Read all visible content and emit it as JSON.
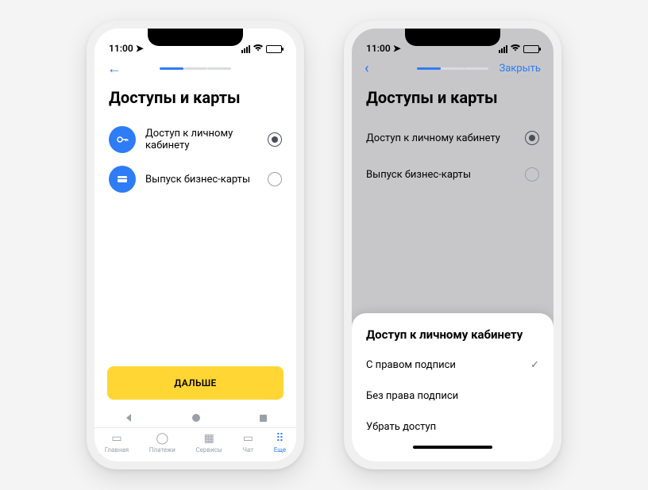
{
  "status": {
    "time": "11:00"
  },
  "left_phone": {
    "title": "Доступы и карты",
    "options": [
      {
        "label": "Доступ к личному кабинету",
        "selected": true
      },
      {
        "label": "Выпуск бизнес-карты",
        "selected": false
      }
    ],
    "primary_button": "ДАЛЬШЕ",
    "tabs": [
      {
        "label": "Главная"
      },
      {
        "label": "Платежи"
      },
      {
        "label": "Сервисы"
      },
      {
        "label": "Чат"
      },
      {
        "label": "Еще"
      }
    ]
  },
  "right_phone": {
    "close_label": "Закрыть",
    "title": "Доступы и карты",
    "options": [
      {
        "label": "Доступ к личному кабинету",
        "selected": true
      },
      {
        "label": "Выпуск бизнес-карты",
        "selected": false
      }
    ],
    "sheet": {
      "title": "Доступ к личному кабинету",
      "items": [
        {
          "label": "С правом подписи",
          "checked": true
        },
        {
          "label": "Без права подписи",
          "checked": false
        },
        {
          "label": "Убрать доступ",
          "checked": false
        }
      ]
    }
  }
}
